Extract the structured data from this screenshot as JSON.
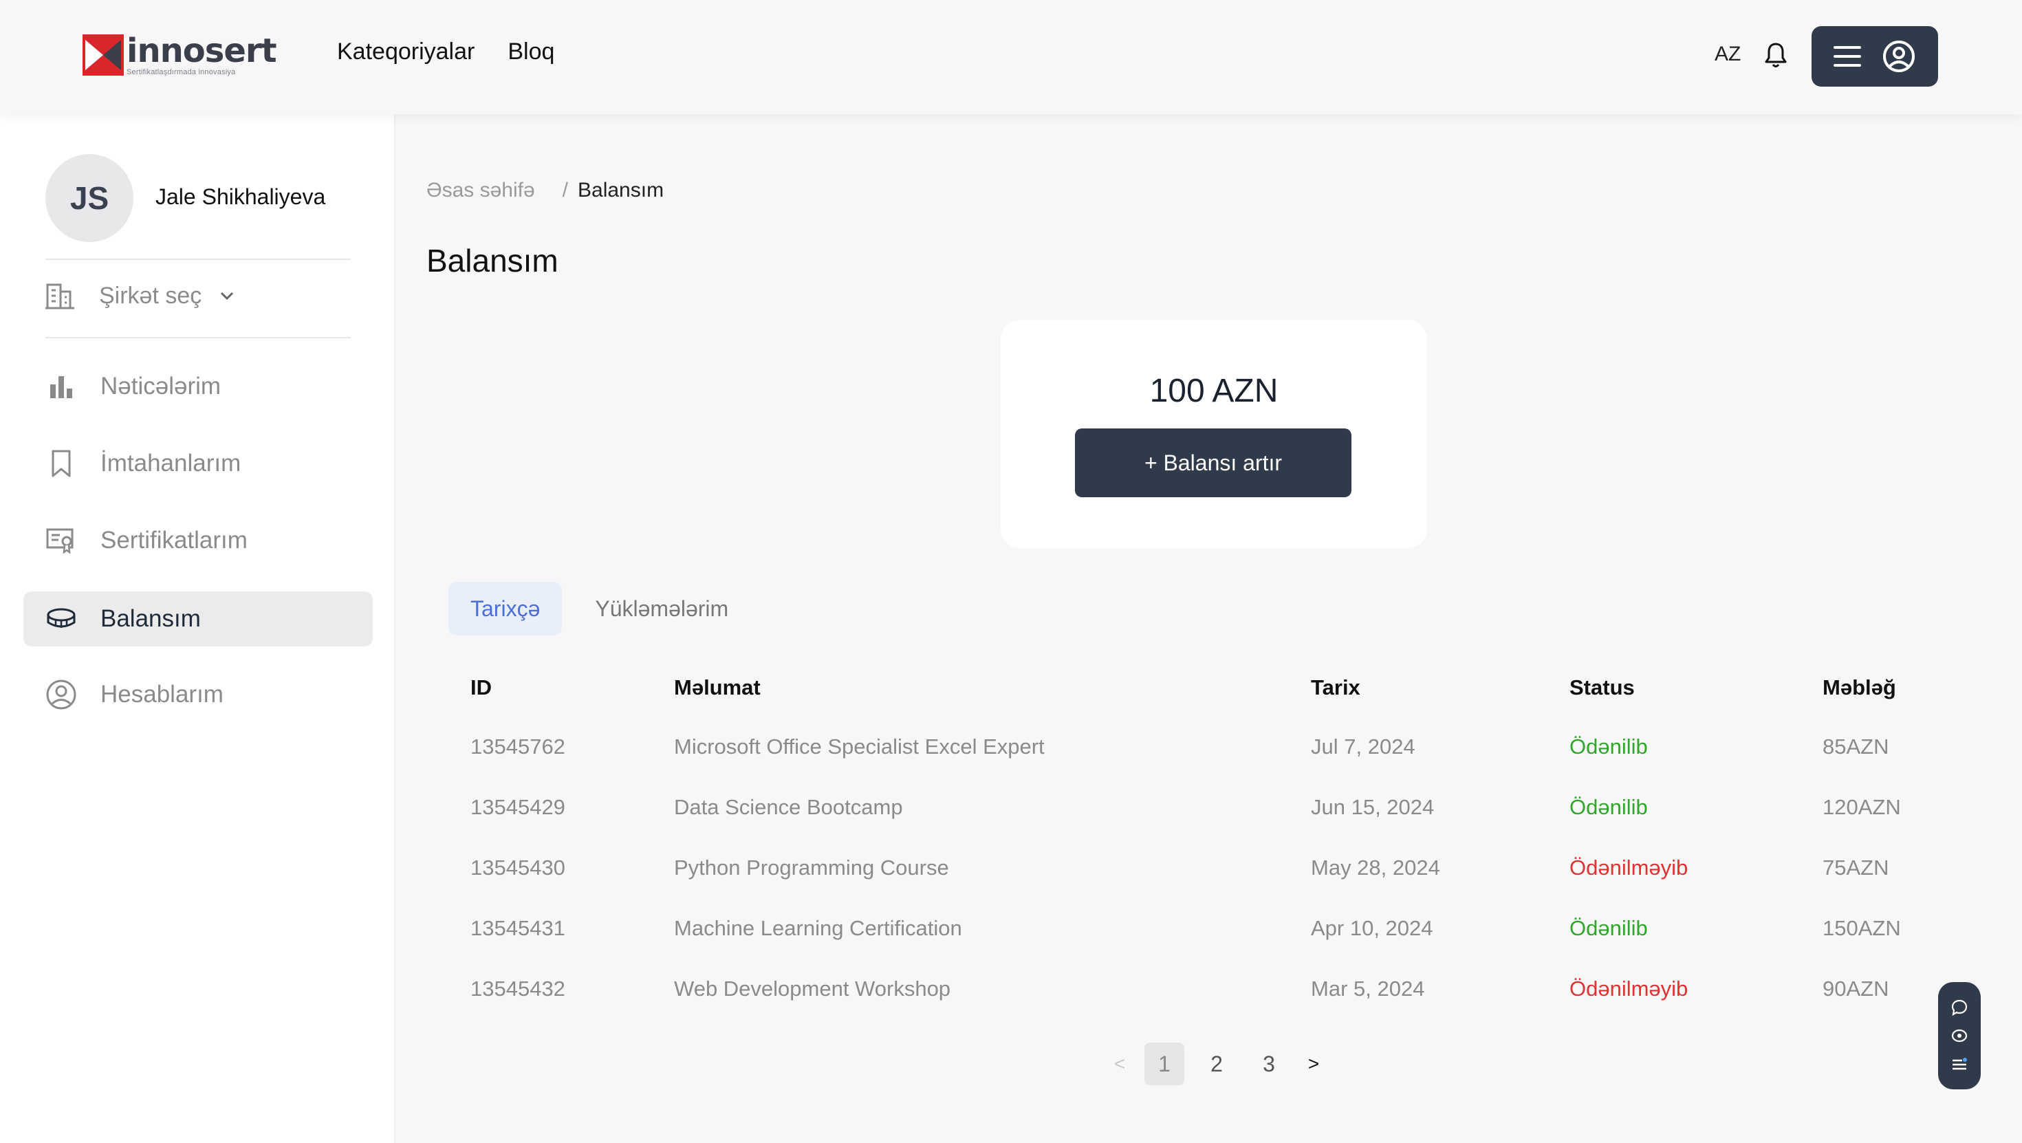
{
  "header": {
    "logo_name": "innosert",
    "logo_tagline": "Sertifikatlaşdırmada innovasiya",
    "nav": [
      "Kateqoriyalar",
      "Bloq"
    ],
    "language": "AZ"
  },
  "sidebar": {
    "avatar_initials": "JS",
    "user_name": "Jale Shikhaliyeva",
    "company_select": "Şirkət seç",
    "items": [
      {
        "label": "Nəticələrim",
        "icon": "bar-chart-icon"
      },
      {
        "label": "İmtahanlarım",
        "icon": "bookmark-icon"
      },
      {
        "label": "Sertifikatlarım",
        "icon": "certificate-icon"
      },
      {
        "label": "Balansım",
        "icon": "coins-icon",
        "active": true
      },
      {
        "label": "Hesablarım",
        "icon": "user-circle-icon"
      }
    ]
  },
  "breadcrumb": {
    "home": "Əsas səhifə",
    "separator": "/",
    "current": "Balansım"
  },
  "page_title": "Balansım",
  "balance": {
    "amount": "100 AZN",
    "topup_label": "+ Balansı artır"
  },
  "tabs": [
    {
      "label": "Tarixçə",
      "active": true
    },
    {
      "label": "Yükləmələrim",
      "active": false
    }
  ],
  "table": {
    "headers": [
      "ID",
      "Məlumat",
      "Tarix",
      "Status",
      "Məbləğ"
    ],
    "rows": [
      {
        "id": "13545762",
        "info": "Microsoft Office Specialist Excel Expert",
        "date": "Jul 7, 2024",
        "status": "Ödənilib",
        "paid": true,
        "amount": "85AZN"
      },
      {
        "id": "13545429",
        "info": "Data Science Bootcamp",
        "date": "Jun 15, 2024",
        "status": "Ödənilib",
        "paid": true,
        "amount": "120AZN"
      },
      {
        "id": "13545430",
        "info": "Python Programming Course",
        "date": "May 28, 2024",
        "status": "Ödənilməyib",
        "paid": false,
        "amount": "75AZN"
      },
      {
        "id": "13545431",
        "info": "Machine Learning Certification",
        "date": "Apr 10, 2024",
        "status": "Ödənilib",
        "paid": true,
        "amount": "150AZN"
      },
      {
        "id": "13545432",
        "info": "Web Development Workshop",
        "date": "Mar 5, 2024",
        "status": "Ödənilməyib",
        "paid": false,
        "amount": "90AZN"
      }
    ]
  },
  "pagination": {
    "prev": "<",
    "pages": [
      "1",
      "2",
      "3"
    ],
    "current": "1",
    "next": ">"
  },
  "colors": {
    "primary_dark": "#2f3a4a",
    "paid": "#2fa52b",
    "unpaid": "#e03232",
    "tab_active": "#4a6fd8",
    "brand_red": "#d9262a"
  }
}
